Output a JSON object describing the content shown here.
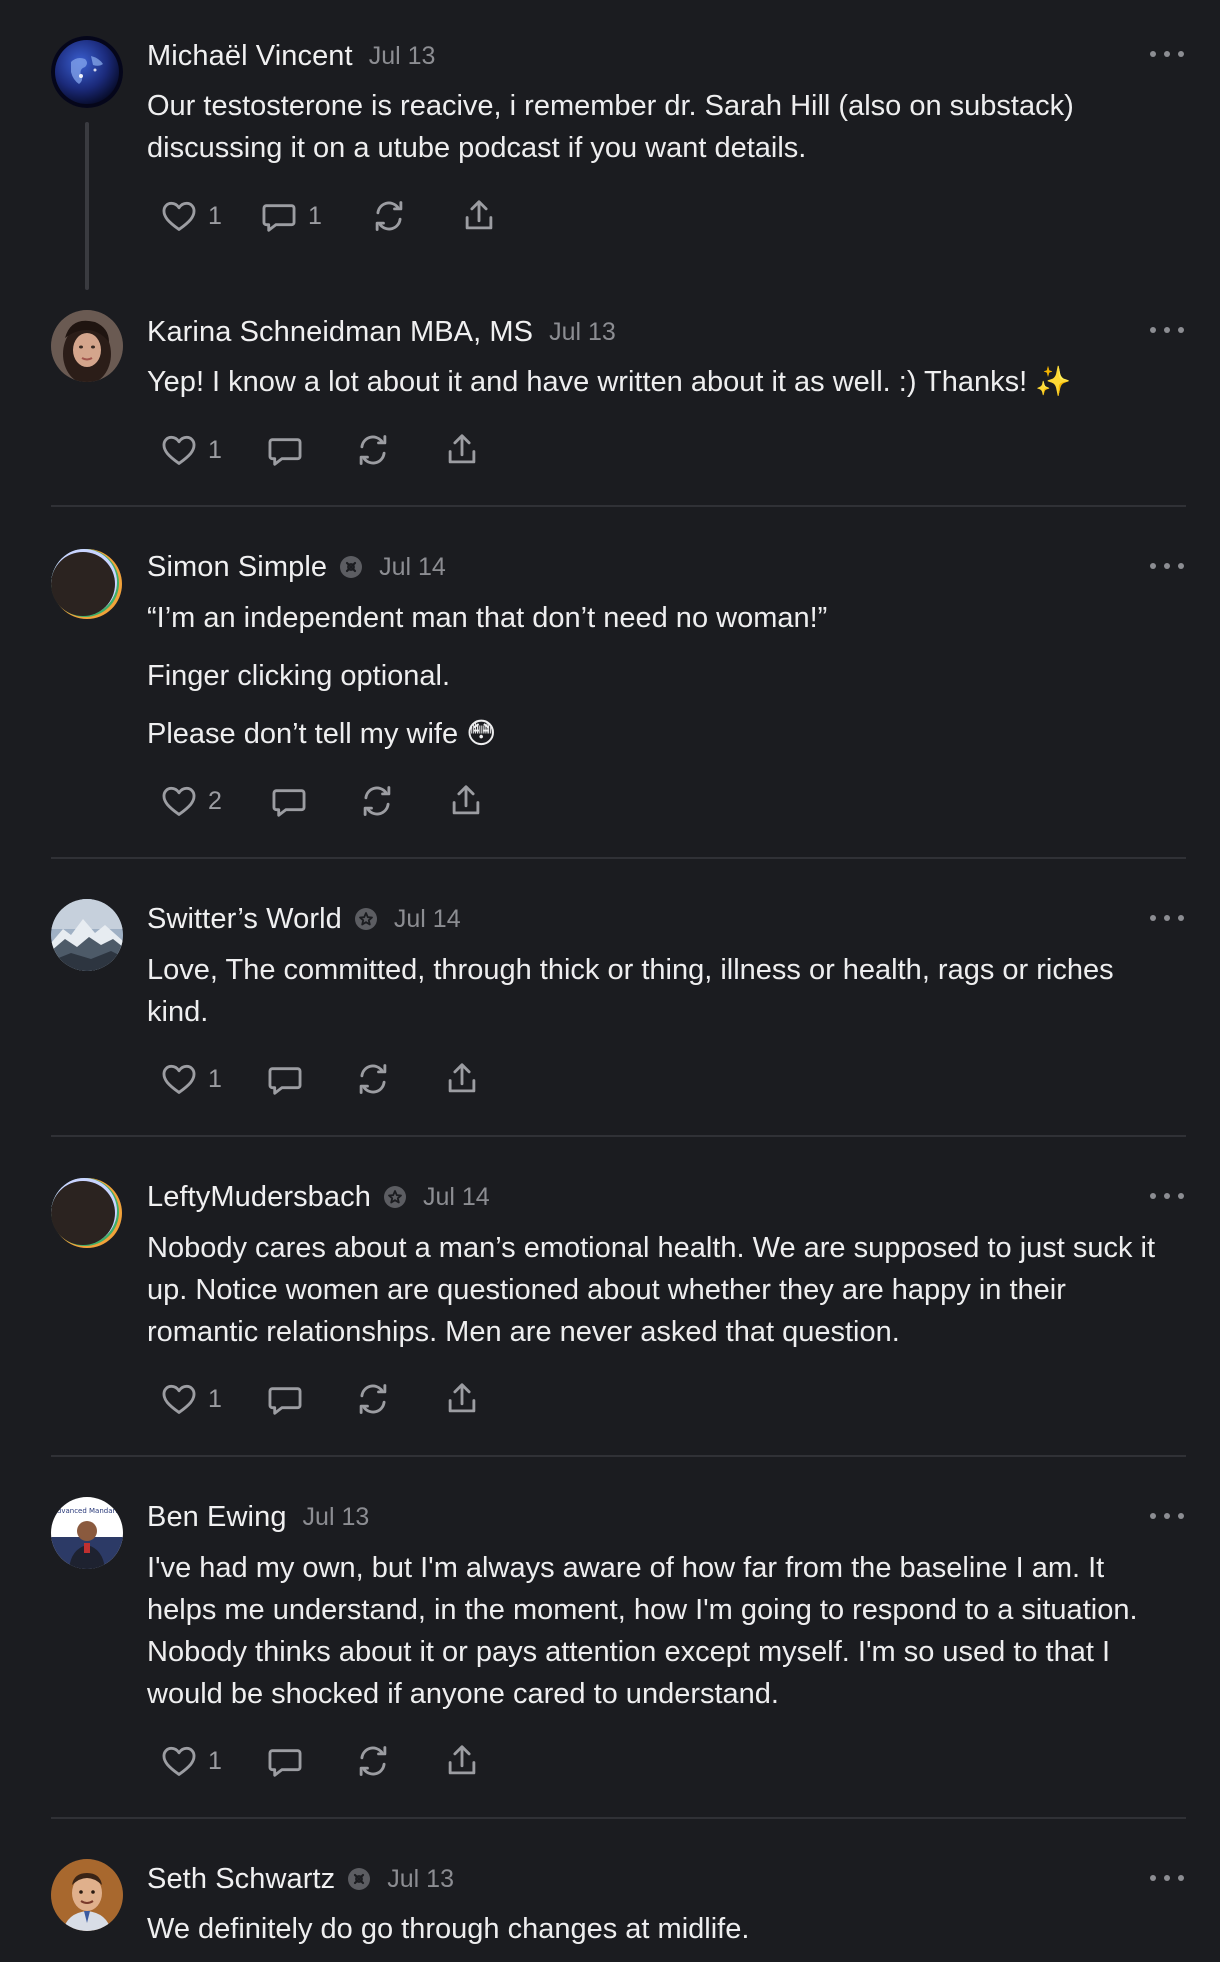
{
  "comments": [
    {
      "name": "Michaël Vincent",
      "date": "Jul 13",
      "avatar": "earth-globe-avatar",
      "paragraphs": [
        "Our testosterone is reacive, i remember dr. Sarah Hill (also on substack) discussing it on a utube podcast if you want details."
      ],
      "likes": "1",
      "replies": "1"
    },
    {
      "name": "Karina Schneidman MBA, MS",
      "date": "Jul 13",
      "avatar": "portrait-photo-avatar",
      "paragraphs": [
        "Yep! I know a lot about it and have written about it as well. :) Thanks! ✨"
      ],
      "likes": "1",
      "replies": ""
    },
    {
      "name": "Simon Simple",
      "date": "Jul 14",
      "avatar": "default-eclipse-avatar",
      "paragraphs": [
        "“I’m an independent man that don’t need no woman!”",
        "Finger clicking optional.",
        "Please don’t tell my wife 😳"
      ],
      "likes": "2",
      "replies": ""
    },
    {
      "name": "Switter’s World",
      "date": "Jul 14",
      "avatar": "mountain-photo-avatar",
      "paragraphs": [
        "Love, The committed, through thick or thing, illness or health, rags or riches kind."
      ],
      "likes": "1",
      "replies": ""
    },
    {
      "name": "LeftyMudersbach",
      "date": "Jul 14",
      "avatar": "default-eclipse-avatar",
      "paragraphs": [
        "Nobody cares about a man’s emotional health. We are supposed to just suck it up. Notice women are questioned about whether they are happy in their romantic relationships. Men are never asked that question."
      ],
      "likes": "1",
      "replies": ""
    },
    {
      "name": "Ben Ewing",
      "date": "Jul 13",
      "avatar": "person-photo-avatar",
      "avatar_text": "Advanced Mandarin",
      "paragraphs": [
        "I've had my own, but I'm always aware of how far from the baseline I am. It helps me understand, in the moment, how I'm going to respond to a situation. Nobody thinks about it or pays attention except myself. I'm so used to that I would be shocked if anyone cared to understand."
      ],
      "likes": "1",
      "replies": ""
    },
    {
      "name": "Seth Schwartz",
      "date": "Jul 13",
      "avatar": "portrait-photo-avatar",
      "paragraphs": [
        "We definitely do go through changes at midlife."
      ],
      "likes": "",
      "replies": ""
    }
  ],
  "colors": {
    "background": "#1b1c20",
    "text": "#eeeeef",
    "muted": "#8c8d92",
    "divider": "#303136"
  }
}
